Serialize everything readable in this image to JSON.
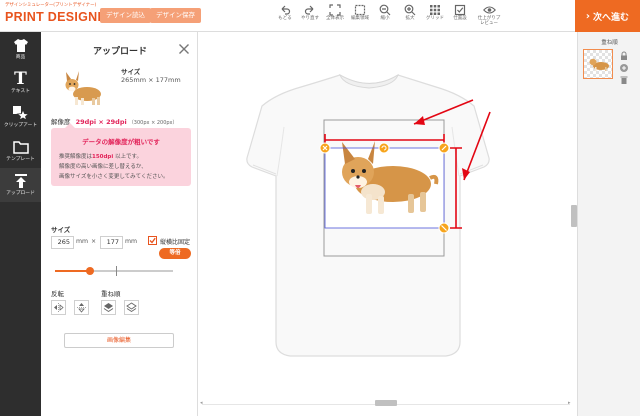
{
  "header": {
    "logo_tagline": "デザインシミュレーター(プリントデザイナー)",
    "logo_title": "PRINT DESIGNER",
    "load_design_label": "デザイン読込",
    "save_design_label": "デザイン保存",
    "tools": [
      {
        "label": "もどる",
        "icon": "undo-icon"
      },
      {
        "label": "やり直す",
        "icon": "redo-icon"
      },
      {
        "label": "全体表示",
        "icon": "fit-screen-icon"
      },
      {
        "label": "編集領域",
        "icon": "edit-area-icon"
      },
      {
        "label": "縮小",
        "icon": "zoom-out-icon"
      },
      {
        "label": "拡大",
        "icon": "zoom-in-icon"
      },
      {
        "label": "グリッド",
        "icon": "grid-icon"
      },
      {
        "label": "仕置設",
        "icon": "checkbox-icon"
      },
      {
        "label": "仕上がりプレビュー",
        "icon": "eye-icon"
      }
    ],
    "next_label": "次へ進む"
  },
  "sidebar": {
    "items": [
      {
        "label": "商品",
        "icon": "tshirt-icon"
      },
      {
        "label": "テキスト",
        "icon": "text-icon"
      },
      {
        "label": "クリップアート",
        "icon": "clipart-icon"
      },
      {
        "label": "テンプレート",
        "icon": "template-folder-icon"
      },
      {
        "label": "アップロード",
        "icon": "upload-icon"
      }
    ]
  },
  "panel": {
    "title": "アップロード",
    "size_label": "サイズ",
    "size_value": "265mm × 177mm",
    "resolution_label": "解像度",
    "resolution_value": "29dpi × 29dpi",
    "resolution_note": "（300px × 200px）",
    "warning_title": "データの解像度が粗いです",
    "warning_lines": {
      "line1_prefix": "推奨解像度は",
      "line1_value": "150dpi",
      "line1_suffix": " 以上です。",
      "line2": "解像度の高い画像に差し替えるか、",
      "line3": "画像サイズを小さく変更してみてください。"
    },
    "size_section_label": "サイズ",
    "width_value": "265",
    "height_value": "177",
    "unit_mm": "mm",
    "times_symbol": "×",
    "keep_ratio_label": "縦横比固定",
    "keep_ratio_checked": true,
    "equal_size_label": "等倍",
    "scale_slider_percent": 30,
    "flip_label": "反転",
    "order_label": "重ね順",
    "edit_image_label": "画像編集"
  },
  "layers": {
    "title": "重ね順"
  },
  "colors": {
    "accent": "#ee6a22",
    "warning_pink": "#e2245a",
    "annotation_red": "#e30613",
    "guide_blue": "#4a52d8"
  }
}
